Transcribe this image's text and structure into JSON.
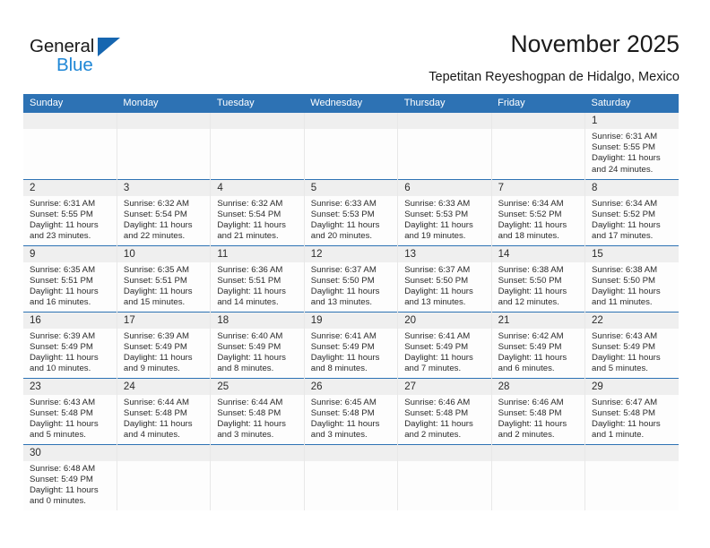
{
  "brand": {
    "name_part1": "General",
    "name_part2": "Blue",
    "flag_icon": "triangle-flag-icon",
    "colors": {
      "black": "#1a1a1a",
      "blue": "#1f87d6",
      "flag": "#1666b0"
    }
  },
  "header": {
    "title": "November 2025",
    "subtitle": "Tepetitan Reyeshogpan de Hidalgo, Mexico"
  },
  "theme": {
    "header_blue": "#2d72b4",
    "daynum_gray": "#efefef",
    "separator_blue": "#2d72b4"
  },
  "weekday_headers": [
    "Sunday",
    "Monday",
    "Tuesday",
    "Wednesday",
    "Thursday",
    "Friday",
    "Saturday"
  ],
  "weeks": [
    [
      {
        "day": ""
      },
      {
        "day": ""
      },
      {
        "day": ""
      },
      {
        "day": ""
      },
      {
        "day": ""
      },
      {
        "day": ""
      },
      {
        "day": "1",
        "sunrise": "Sunrise: 6:31 AM",
        "sunset": "Sunset: 5:55 PM",
        "daylight": "Daylight: 11 hours and 24 minutes."
      }
    ],
    [
      {
        "day": "2",
        "sunrise": "Sunrise: 6:31 AM",
        "sunset": "Sunset: 5:55 PM",
        "daylight": "Daylight: 11 hours and 23 minutes."
      },
      {
        "day": "3",
        "sunrise": "Sunrise: 6:32 AM",
        "sunset": "Sunset: 5:54 PM",
        "daylight": "Daylight: 11 hours and 22 minutes."
      },
      {
        "day": "4",
        "sunrise": "Sunrise: 6:32 AM",
        "sunset": "Sunset: 5:54 PM",
        "daylight": "Daylight: 11 hours and 21 minutes."
      },
      {
        "day": "5",
        "sunrise": "Sunrise: 6:33 AM",
        "sunset": "Sunset: 5:53 PM",
        "daylight": "Daylight: 11 hours and 20 minutes."
      },
      {
        "day": "6",
        "sunrise": "Sunrise: 6:33 AM",
        "sunset": "Sunset: 5:53 PM",
        "daylight": "Daylight: 11 hours and 19 minutes."
      },
      {
        "day": "7",
        "sunrise": "Sunrise: 6:34 AM",
        "sunset": "Sunset: 5:52 PM",
        "daylight": "Daylight: 11 hours and 18 minutes."
      },
      {
        "day": "8",
        "sunrise": "Sunrise: 6:34 AM",
        "sunset": "Sunset: 5:52 PM",
        "daylight": "Daylight: 11 hours and 17 minutes."
      }
    ],
    [
      {
        "day": "9",
        "sunrise": "Sunrise: 6:35 AM",
        "sunset": "Sunset: 5:51 PM",
        "daylight": "Daylight: 11 hours and 16 minutes."
      },
      {
        "day": "10",
        "sunrise": "Sunrise: 6:35 AM",
        "sunset": "Sunset: 5:51 PM",
        "daylight": "Daylight: 11 hours and 15 minutes."
      },
      {
        "day": "11",
        "sunrise": "Sunrise: 6:36 AM",
        "sunset": "Sunset: 5:51 PM",
        "daylight": "Daylight: 11 hours and 14 minutes."
      },
      {
        "day": "12",
        "sunrise": "Sunrise: 6:37 AM",
        "sunset": "Sunset: 5:50 PM",
        "daylight": "Daylight: 11 hours and 13 minutes."
      },
      {
        "day": "13",
        "sunrise": "Sunrise: 6:37 AM",
        "sunset": "Sunset: 5:50 PM",
        "daylight": "Daylight: 11 hours and 13 minutes."
      },
      {
        "day": "14",
        "sunrise": "Sunrise: 6:38 AM",
        "sunset": "Sunset: 5:50 PM",
        "daylight": "Daylight: 11 hours and 12 minutes."
      },
      {
        "day": "15",
        "sunrise": "Sunrise: 6:38 AM",
        "sunset": "Sunset: 5:50 PM",
        "daylight": "Daylight: 11 hours and 11 minutes."
      }
    ],
    [
      {
        "day": "16",
        "sunrise": "Sunrise: 6:39 AM",
        "sunset": "Sunset: 5:49 PM",
        "daylight": "Daylight: 11 hours and 10 minutes."
      },
      {
        "day": "17",
        "sunrise": "Sunrise: 6:39 AM",
        "sunset": "Sunset: 5:49 PM",
        "daylight": "Daylight: 11 hours and 9 minutes."
      },
      {
        "day": "18",
        "sunrise": "Sunrise: 6:40 AM",
        "sunset": "Sunset: 5:49 PM",
        "daylight": "Daylight: 11 hours and 8 minutes."
      },
      {
        "day": "19",
        "sunrise": "Sunrise: 6:41 AM",
        "sunset": "Sunset: 5:49 PM",
        "daylight": "Daylight: 11 hours and 8 minutes."
      },
      {
        "day": "20",
        "sunrise": "Sunrise: 6:41 AM",
        "sunset": "Sunset: 5:49 PM",
        "daylight": "Daylight: 11 hours and 7 minutes."
      },
      {
        "day": "21",
        "sunrise": "Sunrise: 6:42 AM",
        "sunset": "Sunset: 5:49 PM",
        "daylight": "Daylight: 11 hours and 6 minutes."
      },
      {
        "day": "22",
        "sunrise": "Sunrise: 6:43 AM",
        "sunset": "Sunset: 5:49 PM",
        "daylight": "Daylight: 11 hours and 5 minutes."
      }
    ],
    [
      {
        "day": "23",
        "sunrise": "Sunrise: 6:43 AM",
        "sunset": "Sunset: 5:48 PM",
        "daylight": "Daylight: 11 hours and 5 minutes."
      },
      {
        "day": "24",
        "sunrise": "Sunrise: 6:44 AM",
        "sunset": "Sunset: 5:48 PM",
        "daylight": "Daylight: 11 hours and 4 minutes."
      },
      {
        "day": "25",
        "sunrise": "Sunrise: 6:44 AM",
        "sunset": "Sunset: 5:48 PM",
        "daylight": "Daylight: 11 hours and 3 minutes."
      },
      {
        "day": "26",
        "sunrise": "Sunrise: 6:45 AM",
        "sunset": "Sunset: 5:48 PM",
        "daylight": "Daylight: 11 hours and 3 minutes."
      },
      {
        "day": "27",
        "sunrise": "Sunrise: 6:46 AM",
        "sunset": "Sunset: 5:48 PM",
        "daylight": "Daylight: 11 hours and 2 minutes."
      },
      {
        "day": "28",
        "sunrise": "Sunrise: 6:46 AM",
        "sunset": "Sunset: 5:48 PM",
        "daylight": "Daylight: 11 hours and 2 minutes."
      },
      {
        "day": "29",
        "sunrise": "Sunrise: 6:47 AM",
        "sunset": "Sunset: 5:48 PM",
        "daylight": "Daylight: 11 hours and 1 minute."
      }
    ],
    [
      {
        "day": "30",
        "sunrise": "Sunrise: 6:48 AM",
        "sunset": "Sunset: 5:49 PM",
        "daylight": "Daylight: 11 hours and 0 minutes."
      },
      {
        "day": ""
      },
      {
        "day": ""
      },
      {
        "day": ""
      },
      {
        "day": ""
      },
      {
        "day": ""
      },
      {
        "day": ""
      }
    ]
  ]
}
